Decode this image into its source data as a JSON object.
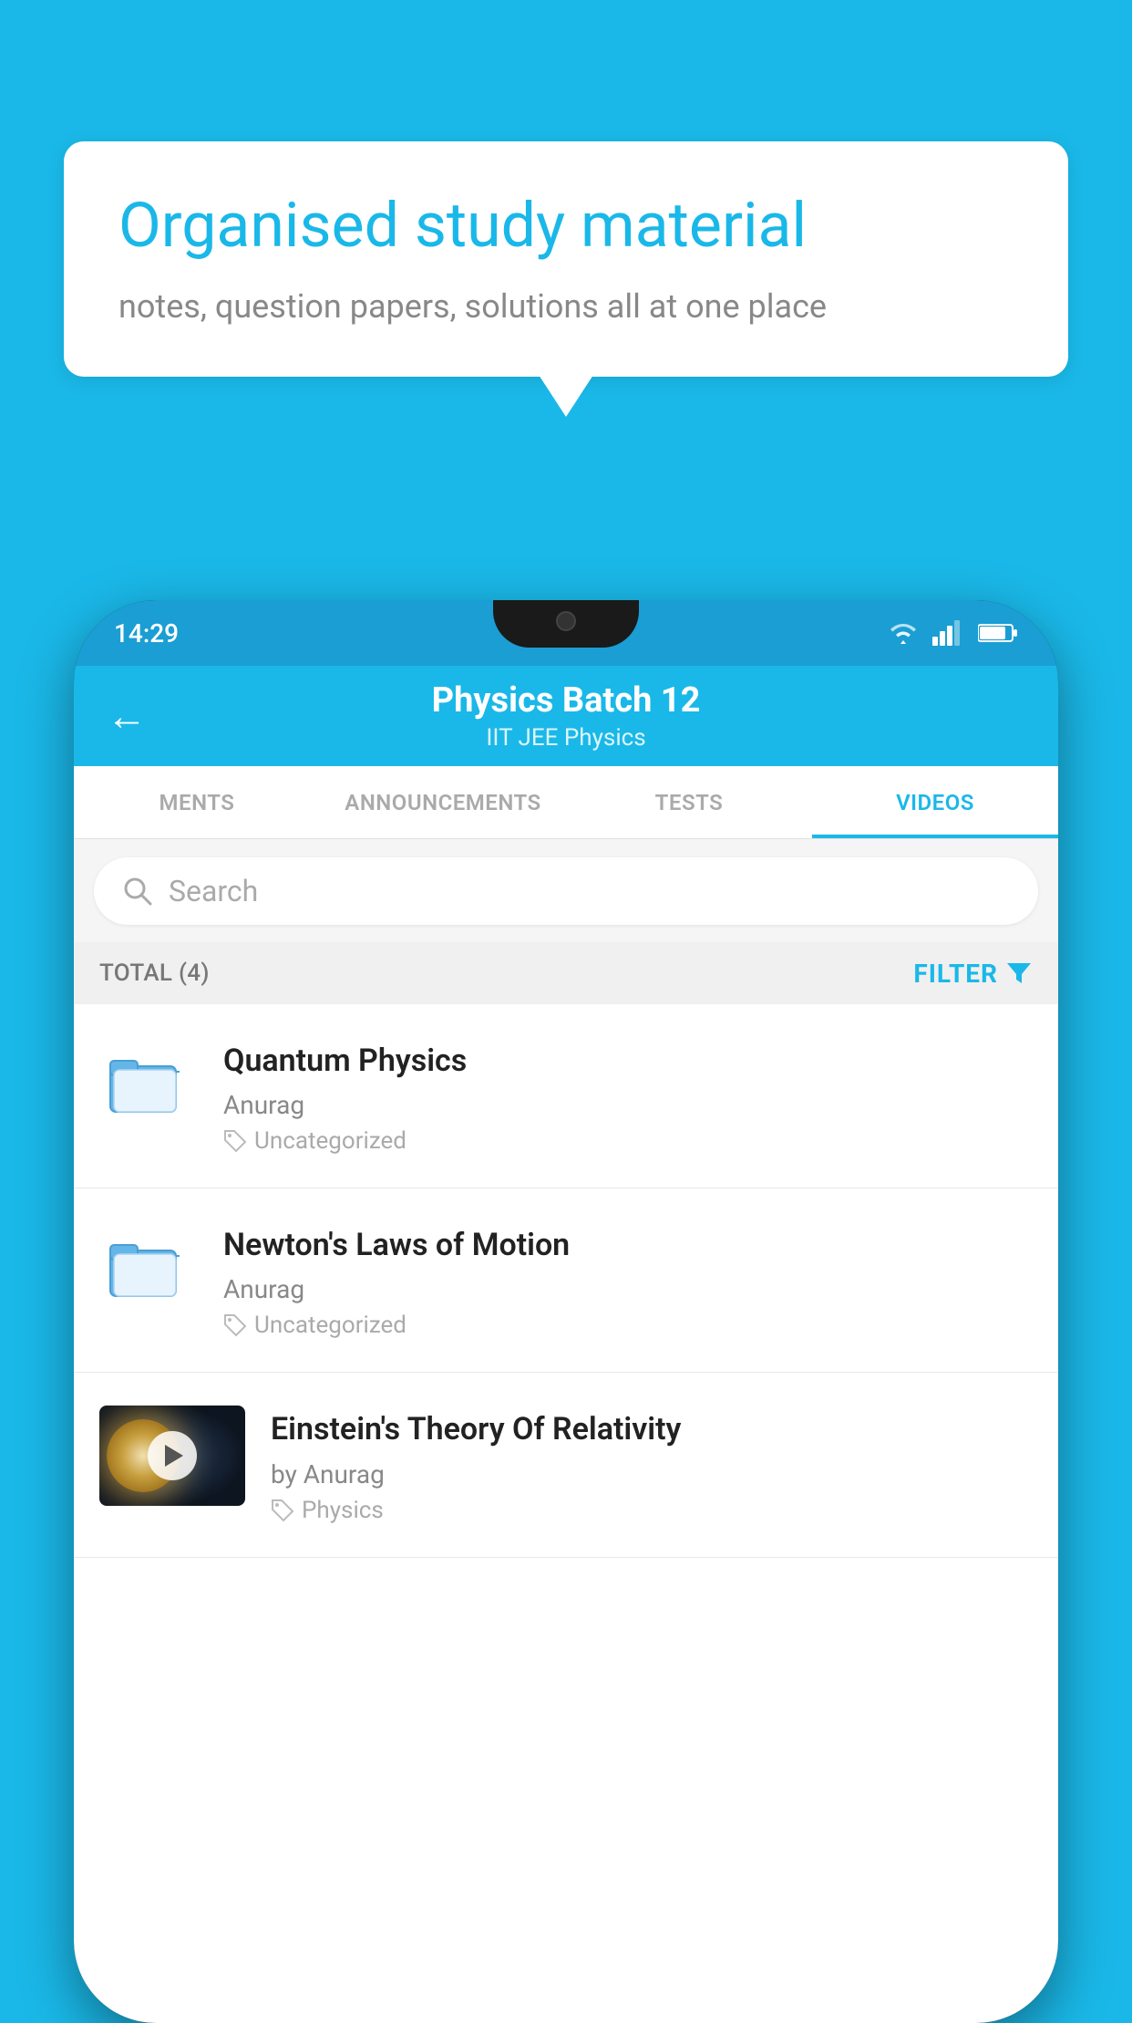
{
  "background_color": "#1ab8e8",
  "speech_bubble": {
    "title": "Organised study material",
    "subtitle": "notes, question papers, solutions all at one place"
  },
  "phone": {
    "status_bar": {
      "time": "14:29",
      "wifi": "wifi",
      "signal": "signal",
      "battery": "battery"
    },
    "header": {
      "title": "Physics Batch 12",
      "subtitle": "IIT JEE   Physics",
      "back_label": "←"
    },
    "tabs": [
      {
        "label": "MENTS",
        "active": false
      },
      {
        "label": "ANNOUNCEMENTS",
        "active": false
      },
      {
        "label": "TESTS",
        "active": false
      },
      {
        "label": "VIDEOS",
        "active": true
      }
    ],
    "search": {
      "placeholder": "Search"
    },
    "filter_bar": {
      "total_label": "TOTAL (4)",
      "filter_label": "FILTER"
    },
    "videos": [
      {
        "title": "Quantum Physics",
        "author": "Anurag",
        "tag": "Uncategorized",
        "type": "folder",
        "has_thumbnail": false
      },
      {
        "title": "Newton's Laws of Motion",
        "author": "Anurag",
        "tag": "Uncategorized",
        "type": "folder",
        "has_thumbnail": false
      },
      {
        "title": "Einstein's Theory Of Relativity",
        "author": "by Anurag",
        "tag": "Physics",
        "type": "video",
        "has_thumbnail": true
      }
    ]
  }
}
